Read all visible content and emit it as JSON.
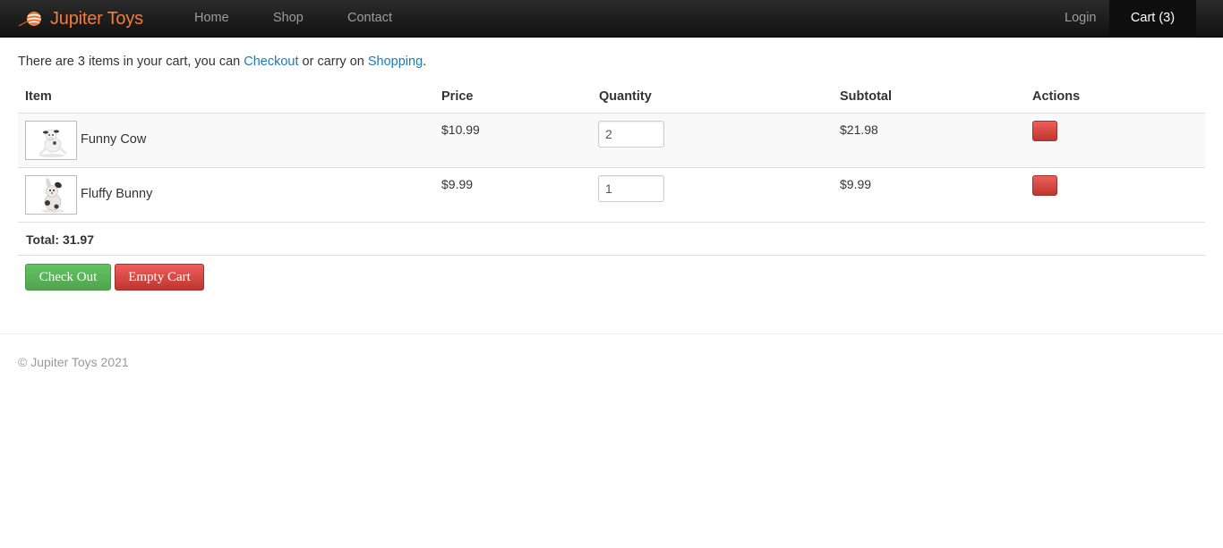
{
  "navbar": {
    "brand": "Jupiter Toys",
    "links": [
      "Home",
      "Shop",
      "Contact"
    ],
    "login": "Login",
    "cart": "Cart (3)"
  },
  "message": {
    "before": "There are 3 items in your cart, you can ",
    "checkout_link": "Checkout",
    "middle": " or carry on ",
    "shopping_link": "Shopping",
    "after": "."
  },
  "table": {
    "headers": [
      "Item",
      "Price",
      "Quantity",
      "Subtotal",
      "Actions"
    ],
    "rows": [
      {
        "item": "Funny Cow",
        "price": "$10.99",
        "quantity": "2",
        "subtotal": "$21.98",
        "icon": "cow-toy-icon"
      },
      {
        "item": "Fluffy Bunny",
        "price": "$9.99",
        "quantity": "1",
        "subtotal": "$9.99",
        "icon": "bunny-toy-icon"
      }
    ],
    "total": "Total: 31.97"
  },
  "buttons": {
    "checkout": "Check Out",
    "empty": "Empty Cart"
  },
  "footer": "© Jupiter Toys 2021",
  "colors": {
    "brand": "#f07d3c",
    "link": "#1b7bb5",
    "success": "#5bb75b",
    "danger": "#da4f49"
  }
}
